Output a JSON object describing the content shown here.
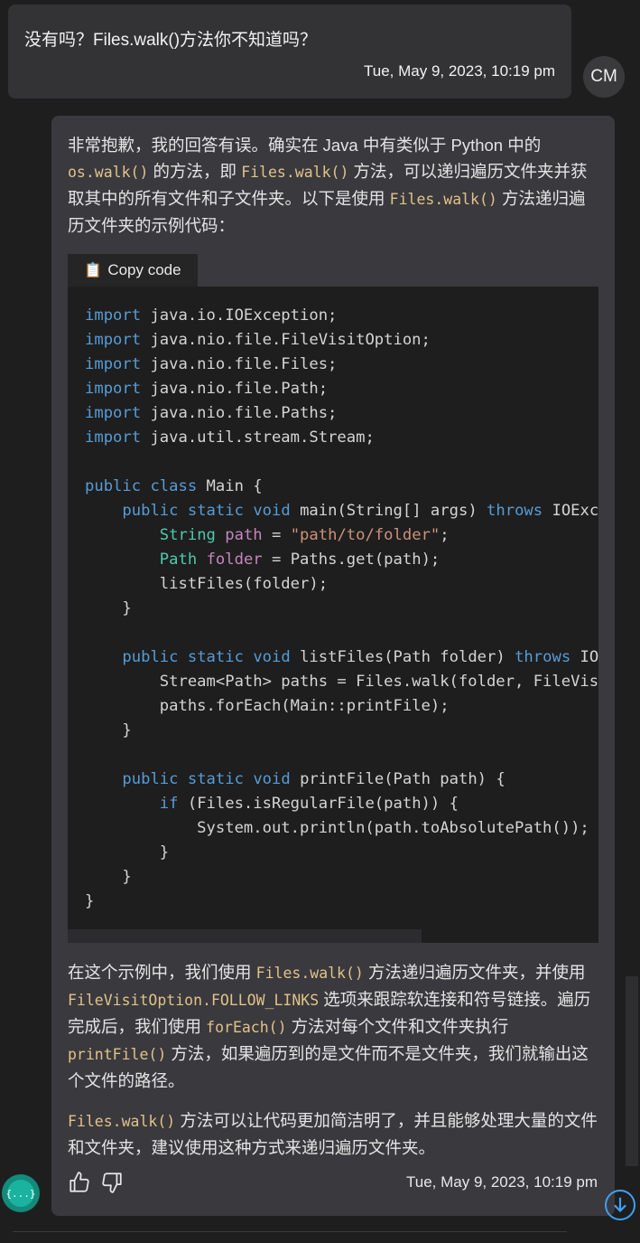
{
  "user_message": {
    "text": "没有吗？Files.walk()方法你不知道吗？",
    "timestamp": "Tue, May 9, 2023, 10:19 pm",
    "avatar_initials": "CM"
  },
  "bot_message": {
    "intro": [
      {
        "t": "非常抱歉，我的回答有误。确实在 Java 中有类似于 Python 中的 "
      },
      {
        "c": "os.walk()"
      },
      {
        "t": " 的方法，即 "
      },
      {
        "c": "Files.walk()"
      },
      {
        "t": " 方法，可以递归遍历文件夹并获取其中的所有文件和子文件夹。以下是使用 "
      },
      {
        "c": "Files.walk()"
      },
      {
        "t": " 方法递归遍历文件夹的示例代码："
      }
    ],
    "copy_label": "Copy code",
    "code_lines": [
      [
        [
          "kw",
          "import"
        ],
        [
          "p",
          " java.io.IOException;"
        ]
      ],
      [
        [
          "kw",
          "import"
        ],
        [
          "p",
          " java.nio.file.FileVisitOption;"
        ]
      ],
      [
        [
          "kw",
          "import"
        ],
        [
          "p",
          " java.nio.file.Files;"
        ]
      ],
      [
        [
          "kw",
          "import"
        ],
        [
          "p",
          " java.nio.file.Path;"
        ]
      ],
      [
        [
          "kw",
          "import"
        ],
        [
          "p",
          " java.nio.file.Paths;"
        ]
      ],
      [
        [
          "kw",
          "import"
        ],
        [
          "p",
          " java.util.stream.Stream;"
        ]
      ],
      [],
      [
        [
          "kw",
          "public"
        ],
        [
          "p",
          " "
        ],
        [
          "kw",
          "class"
        ],
        [
          "p",
          " Main {"
        ]
      ],
      [
        [
          "p",
          "    "
        ],
        [
          "kw",
          "public"
        ],
        [
          "p",
          " "
        ],
        [
          "kw",
          "static"
        ],
        [
          "p",
          " "
        ],
        [
          "kw",
          "void"
        ],
        [
          "p",
          " main(String[] args) "
        ],
        [
          "kw",
          "throws"
        ],
        [
          "p",
          " IOException {"
        ]
      ],
      [
        [
          "p",
          "        "
        ],
        [
          "ty",
          "String"
        ],
        [
          "p",
          " "
        ],
        [
          "vr",
          "path"
        ],
        [
          "p",
          " = "
        ],
        [
          "st",
          "\"path/to/folder\""
        ],
        [
          "p",
          ";"
        ]
      ],
      [
        [
          "p",
          "        "
        ],
        [
          "ty",
          "Path"
        ],
        [
          "p",
          " "
        ],
        [
          "vr",
          "folder"
        ],
        [
          "p",
          " = Paths.get(path);"
        ]
      ],
      [
        [
          "p",
          "        listFiles(folder);"
        ]
      ],
      [
        [
          "p",
          "    }"
        ]
      ],
      [],
      [
        [
          "p",
          "    "
        ],
        [
          "kw",
          "public"
        ],
        [
          "p",
          " "
        ],
        [
          "kw",
          "static"
        ],
        [
          "p",
          " "
        ],
        [
          "kw",
          "void"
        ],
        [
          "p",
          " listFiles(Path folder) "
        ],
        [
          "kw",
          "throws"
        ],
        [
          "p",
          " IOException {"
        ]
      ],
      [
        [
          "p",
          "        Stream<Path> paths = Files.walk(folder, FileVisitOption.FOLLOW_LINKS);"
        ]
      ],
      [
        [
          "p",
          "        paths.forEach(Main::printFile);"
        ]
      ],
      [
        [
          "p",
          "    }"
        ]
      ],
      [],
      [
        [
          "p",
          "    "
        ],
        [
          "kw",
          "public"
        ],
        [
          "p",
          " "
        ],
        [
          "kw",
          "static"
        ],
        [
          "p",
          " "
        ],
        [
          "kw",
          "void"
        ],
        [
          "p",
          " printFile(Path path) {"
        ]
      ],
      [
        [
          "p",
          "        "
        ],
        [
          "kw",
          "if"
        ],
        [
          "p",
          " (Files.isRegularFile(path)) {"
        ]
      ],
      [
        [
          "p",
          "            System.out.println(path.toAbsolutePath());"
        ]
      ],
      [
        [
          "p",
          "        }"
        ]
      ],
      [
        [
          "p",
          "    }"
        ]
      ],
      [
        [
          "p",
          "}"
        ]
      ]
    ],
    "explanation": [
      {
        "t": "在这个示例中，我们使用 "
      },
      {
        "c": "Files.walk()"
      },
      {
        "t": " 方法递归遍历文件夹，并使用 "
      },
      {
        "c": "FileVisitOption.FOLLOW_LINKS"
      },
      {
        "t": " 选项来跟踪软连接和符号链接。遍历完成后，我们使用 "
      },
      {
        "c": "forEach()"
      },
      {
        "t": " 方法对每个文件和文件夹执行 "
      },
      {
        "c": "printFile()"
      },
      {
        "t": " 方法，如果遍历到的是文件而不是文件夹，我们就输出这个文件的路径。"
      }
    ],
    "closing": [
      {
        "c": "Files.walk()"
      },
      {
        "t": " 方法可以让代码更加简洁明了，并且能够处理大量的文件和文件夹，建议使用这种方式来递归遍历文件夹。"
      }
    ],
    "timestamp": "Tue, May 9, 2023, 10:19 pm",
    "avatar_text": "{...}"
  },
  "icons": {
    "thumbs_up": "thumbs-up-icon",
    "thumbs_down": "thumbs-down-icon",
    "scroll_down": "arrow-down-circle-icon",
    "clipboard": "clipboard-icon"
  },
  "colors": {
    "background": "#1e1e1f",
    "user_bubble": "#333335",
    "bot_bubble": "#3a393d",
    "code_background": "#1e1e1e",
    "inline_code": "#e0c28a",
    "keyword": "#569cd6",
    "type": "#4ec9b0",
    "variable": "#c586c0",
    "string": "#ce9178",
    "accent": "#3ea0f5"
  }
}
